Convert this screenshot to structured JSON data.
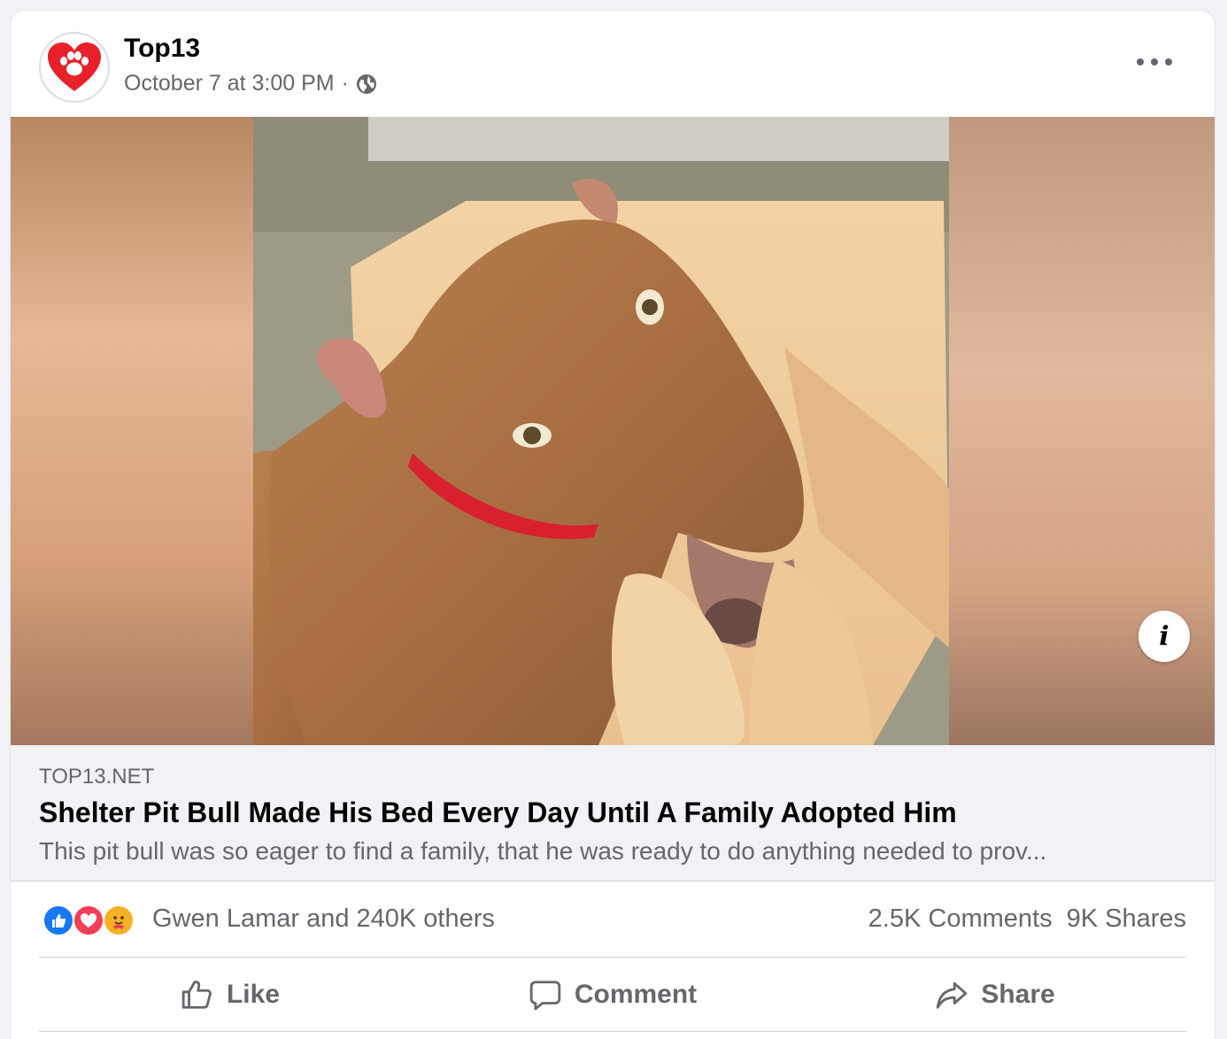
{
  "post": {
    "page_name": "Top13",
    "timestamp": "October 7 at 3:00 PM",
    "separator": "·",
    "privacy_icon": "globe-icon",
    "more_icon": "more-horizontal-icon",
    "info_label": "i"
  },
  "link": {
    "domain": "TOP13.NET",
    "headline": "Shelter Pit Bull Made His Bed Every Day Until A Family Adopted Him",
    "description": "This pit bull was so eager to find a family, that he was ready to do anything needed to prov..."
  },
  "stats": {
    "reaction_icons": [
      "like-reaction-icon",
      "love-reaction-icon",
      "care-reaction-icon"
    ],
    "reactors": "Gwen Lamar and 240K others",
    "comments": "2.5K Comments",
    "shares": "9K Shares"
  },
  "actions": {
    "like": "Like",
    "comment": "Comment",
    "share": "Share"
  },
  "colors": {
    "like_blue": "#1877f2",
    "love_red": "#f33e58",
    "care_yellow": "#f7b125",
    "secondary_text": "#65676b",
    "logo_red": "#e8202a"
  }
}
